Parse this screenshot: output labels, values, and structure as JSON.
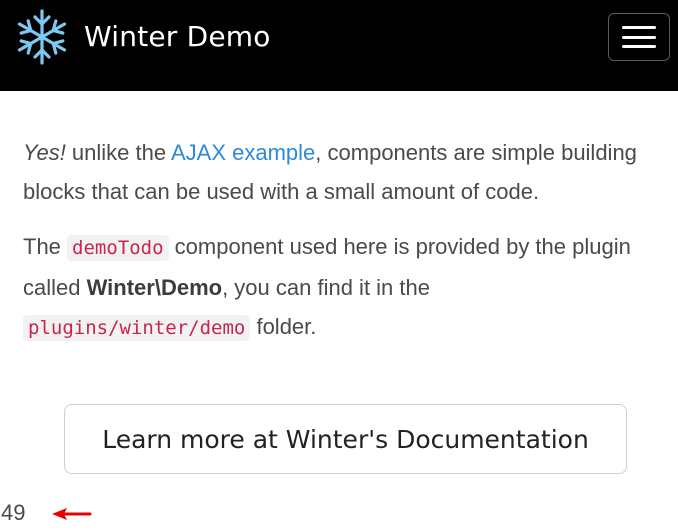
{
  "navbar": {
    "brand_title": "Winter Demo",
    "logo_icon": "snowflake-icon",
    "menu_icon": "hamburger-menu-icon",
    "background_color": "#000000"
  },
  "content": {
    "paragraph1": {
      "lead": "Yes!",
      "text_before_link": " unlike the ",
      "link_text": "AJAX example",
      "text_after_link": ", components are simple building blocks that can be used with a small amount of code."
    },
    "paragraph2": {
      "text_start": "The ",
      "code1": "demoTodo",
      "text_mid1": " component used here is provided by the plugin called ",
      "strong_text": "Winter\\Demo",
      "text_mid2": ", you can find it in the ",
      "code2": "plugins/winter/demo",
      "text_end": " folder."
    }
  },
  "button": {
    "label": "Learn more at Winter's Documentation"
  },
  "footer": {
    "page_number": "49",
    "arrow_icon": "red-left-arrow-icon",
    "arrow_color": "#e60000"
  },
  "colors": {
    "link": "#2e8ad8",
    "code": "#c7254e",
    "text": "#4a4a4a"
  }
}
